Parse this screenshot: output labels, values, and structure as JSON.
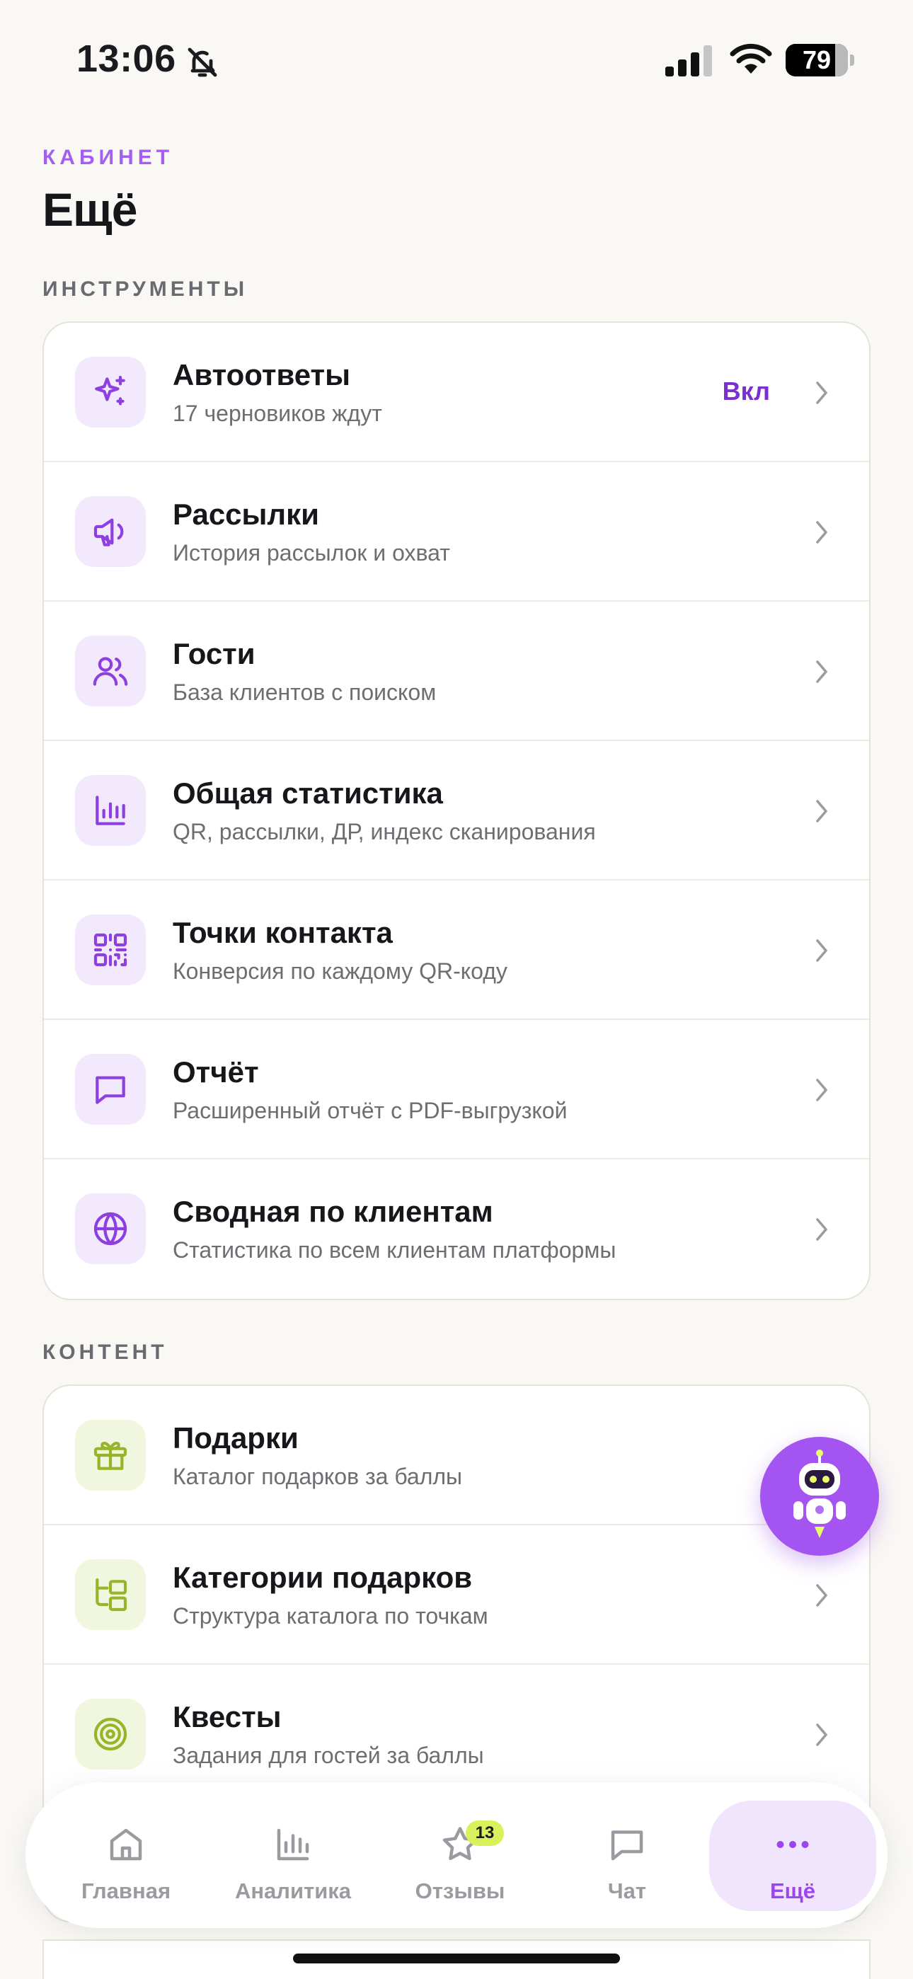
{
  "status_bar": {
    "time": "13:06",
    "battery": "79",
    "battery_level": 0.79
  },
  "header": {
    "overline": "КАБИНЕТ",
    "title": "Ещё"
  },
  "sections": {
    "tools": {
      "title": "ИНСТРУМЕНТЫ",
      "items": [
        {
          "title": "Автоответы",
          "subtitle": "17 черновиков ждут",
          "badge": "Вкл",
          "icon": "sparkles-icon"
        },
        {
          "title": "Рассылки",
          "subtitle": "История рассылок и охват",
          "icon": "megaphone-icon"
        },
        {
          "title": "Гости",
          "subtitle": "База клиентов с поиском",
          "icon": "users-icon"
        },
        {
          "title": "Общая статистика",
          "subtitle": "QR, рассылки, ДР, индекс сканирования",
          "icon": "bar-chart-icon"
        },
        {
          "title": "Точки контакта",
          "subtitle": "Конверсия по каждому QR-коду",
          "icon": "qr-code-icon"
        },
        {
          "title": "Отчёт",
          "subtitle": "Расширенный отчёт с PDF-выгрузкой",
          "icon": "message-square-icon"
        },
        {
          "title": "Сводная по клиентам",
          "subtitle": "Статистика по всем клиентам платформы",
          "icon": "globe-icon"
        }
      ]
    },
    "content": {
      "title": "КОНТЕНТ",
      "items": [
        {
          "title": "Подарки",
          "subtitle": "Каталог подарков за баллы",
          "icon": "gift-icon"
        },
        {
          "title": "Категории подарков",
          "subtitle": "Структура каталога по точкам",
          "icon": "folder-tree-icon"
        },
        {
          "title": "Квесты",
          "subtitle": "Задания для гостей за баллы",
          "icon": "target-icon"
        }
      ]
    }
  },
  "fab": {
    "icon": "robot-assistant-icon"
  },
  "tabbar": {
    "tabs": [
      {
        "label": "Главная",
        "icon": "home-icon"
      },
      {
        "label": "Аналитика",
        "icon": "analytics-icon"
      },
      {
        "label": "Отзывы",
        "icon": "star-icon",
        "badge": "13"
      },
      {
        "label": "Чат",
        "icon": "chat-icon"
      },
      {
        "label": "Ещё",
        "icon": "more-icon",
        "active": true
      }
    ]
  },
  "colors": {
    "background": "#f9f8f4",
    "accent": "#a354f1",
    "accent_text": "#7a2fcf",
    "icon_purple": "#8e3fe0",
    "icon_lime": "#97b52a",
    "badge_lime": "#d7f25a"
  }
}
